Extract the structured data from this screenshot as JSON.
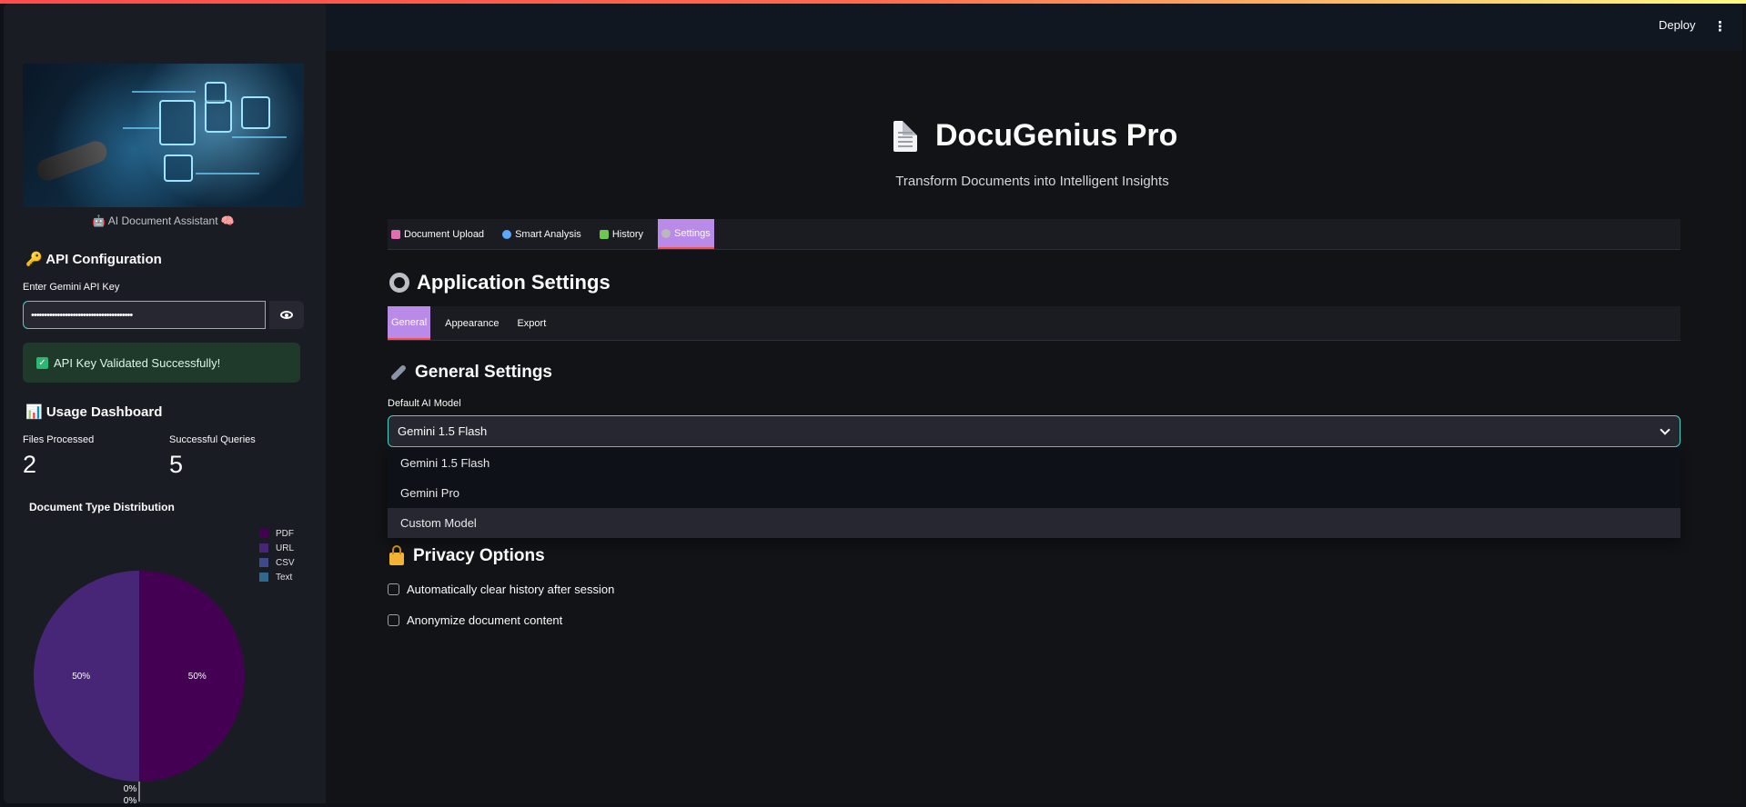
{
  "sidebar": {
    "caption": "🤖 AI Document Assistant 🧠",
    "api_header": "🔑 API Configuration",
    "api_label": "Enter Gemini API Key",
    "api_value": "•••••••••••••••••••••••••••••••••••••••",
    "api_success": "API Key Validated Successfully!",
    "usage_header": "📊 Usage Dashboard",
    "metrics": [
      {
        "label": "Files Processed",
        "value": "2"
      },
      {
        "label": "Successful Queries",
        "value": "5"
      }
    ],
    "chart_title": "Document Type Distribution"
  },
  "chart_data": {
    "type": "pie",
    "title": "Document Type Distribution",
    "categories": [
      "PDF",
      "URL",
      "CSV",
      "Text"
    ],
    "values": [
      50,
      50,
      0,
      0
    ],
    "labels": [
      "50%",
      "50%",
      "0%",
      "0%"
    ],
    "colors": [
      "#440154",
      "#482677",
      "#3e4a89",
      "#31688e"
    ],
    "legend_position": "top-right"
  },
  "header": {
    "deploy_label": "Deploy",
    "menu_icon": "kebab-icon"
  },
  "app": {
    "title": "DocuGenius Pro",
    "subtitle": "Transform Documents into Intelligent Insights"
  },
  "tabs": [
    {
      "label": "Document Upload",
      "icon_color": "#e06fb1"
    },
    {
      "label": "Smart Analysis",
      "icon_color": "#5aa7ff"
    },
    {
      "label": "History",
      "icon_color": "#6cc84f"
    },
    {
      "label": "Settings",
      "icon_color": "#b9b9b9",
      "active": true
    }
  ],
  "settings": {
    "header": "Application Settings",
    "subtabs": [
      {
        "label": "General",
        "active": true
      },
      {
        "label": "Appearance"
      },
      {
        "label": "Export"
      }
    ],
    "general_header": "General Settings",
    "model_label": "Default AI Model",
    "model_value": "Gemini 1.5 Flash",
    "model_options": [
      "Gemini 1.5 Flash",
      "Gemini Pro",
      "Custom Model"
    ],
    "privacy_header": "Privacy Options",
    "privacy_options": [
      "Automatically clear history after session",
      "Anonymize document content"
    ]
  }
}
